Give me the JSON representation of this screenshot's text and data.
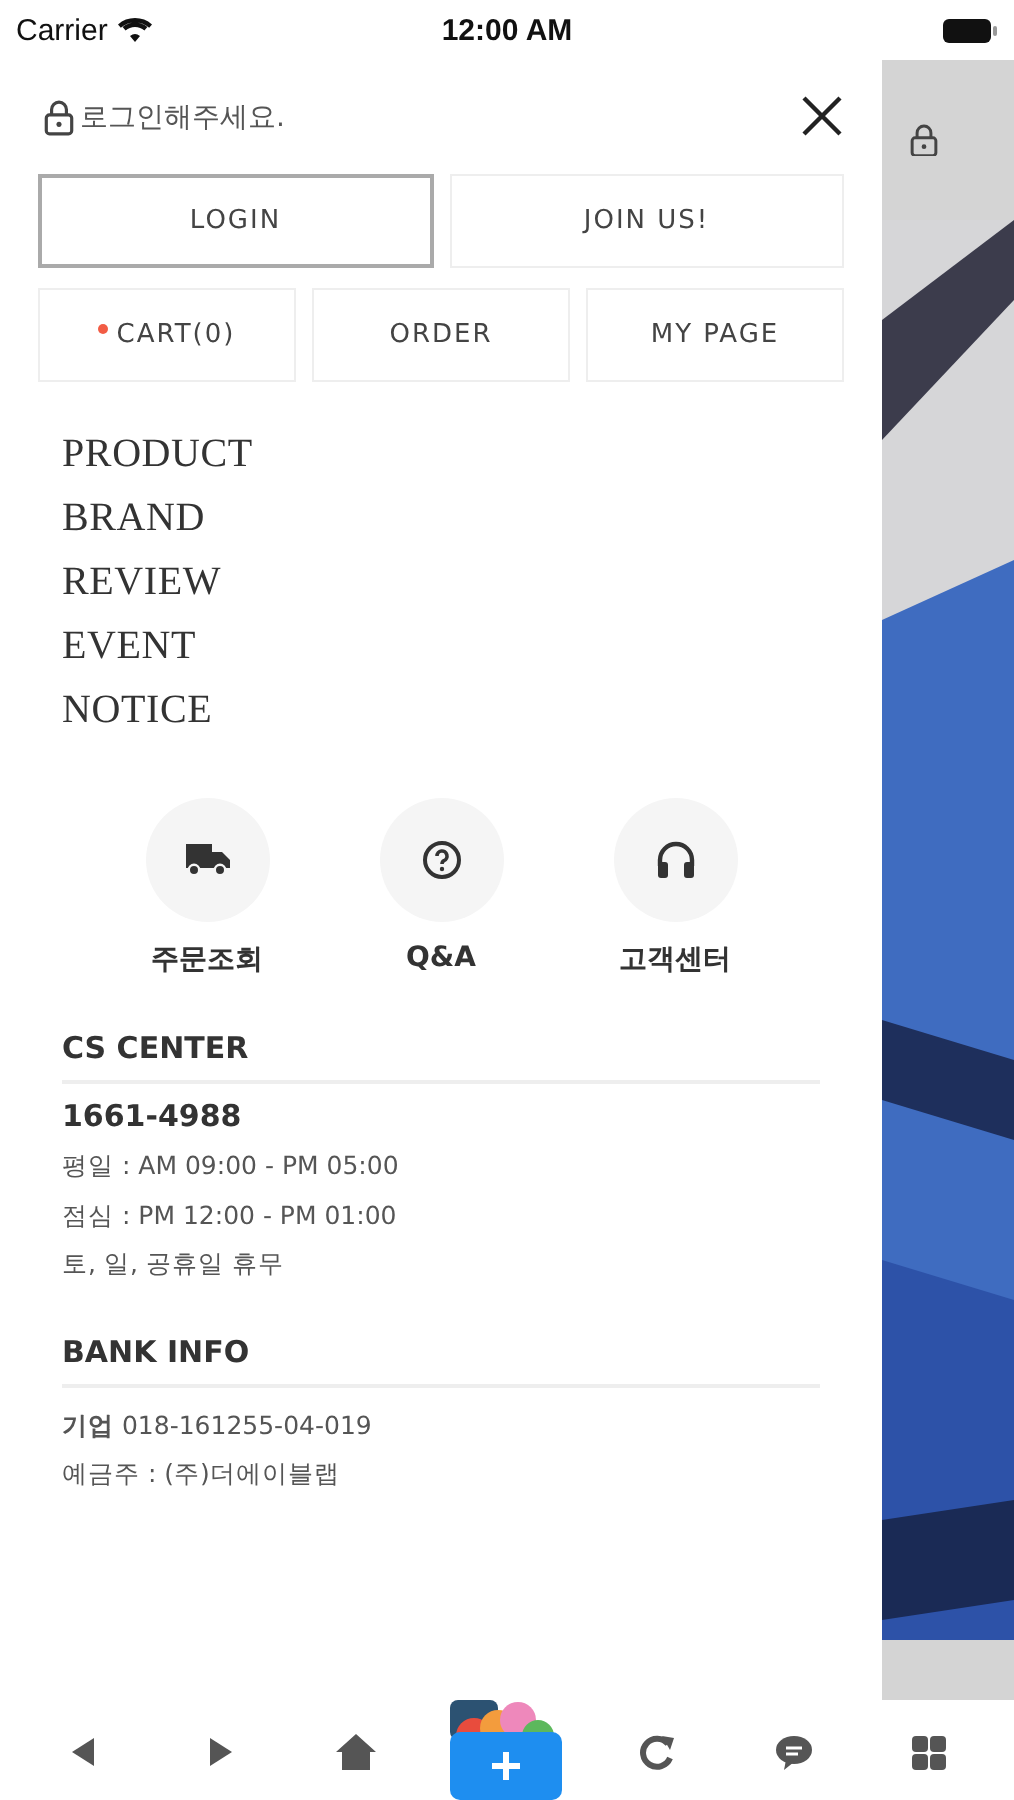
{
  "status_bar": {
    "carrier": "Carrier",
    "time": "12:00 AM"
  },
  "drawer": {
    "login_prompt": "로그인해주세요.",
    "account_buttons": [
      {
        "label": "LOGIN",
        "selected": true
      },
      {
        "label": "JOIN US!",
        "selected": false
      }
    ],
    "shop_buttons": [
      {
        "label": "CART(0)",
        "notify": true
      },
      {
        "label": "ORDER",
        "notify": false
      },
      {
        "label": "MY PAGE",
        "notify": false
      }
    ],
    "menu": [
      "PRODUCT",
      "BRAND",
      "REVIEW",
      "EVENT",
      "NOTICE"
    ],
    "shortcuts": [
      {
        "kind": "truck",
        "label": "주문조회"
      },
      {
        "kind": "question",
        "label": "Q&A"
      },
      {
        "kind": "headset",
        "label": "고객센터"
      }
    ],
    "cs_center": {
      "title": "CS CENTER",
      "phone": "1661-4988",
      "lines": [
        "평일 : AM 09:00 - PM 05:00",
        "점심 : PM 12:00 - PM 01:00",
        "토, 일, 공휴일 휴무"
      ]
    },
    "bank_info": {
      "title": "BANK INFO",
      "account": "**기업** 018-161255-04-019",
      "holder": "예금주 : (주)더에이블랩"
    }
  },
  "toolbar": [
    {
      "kind": "back"
    },
    {
      "kind": "forward"
    },
    {
      "kind": "home"
    },
    {
      "kind": "app"
    },
    {
      "kind": "reload"
    },
    {
      "kind": "chat"
    },
    {
      "kind": "grid"
    }
  ]
}
